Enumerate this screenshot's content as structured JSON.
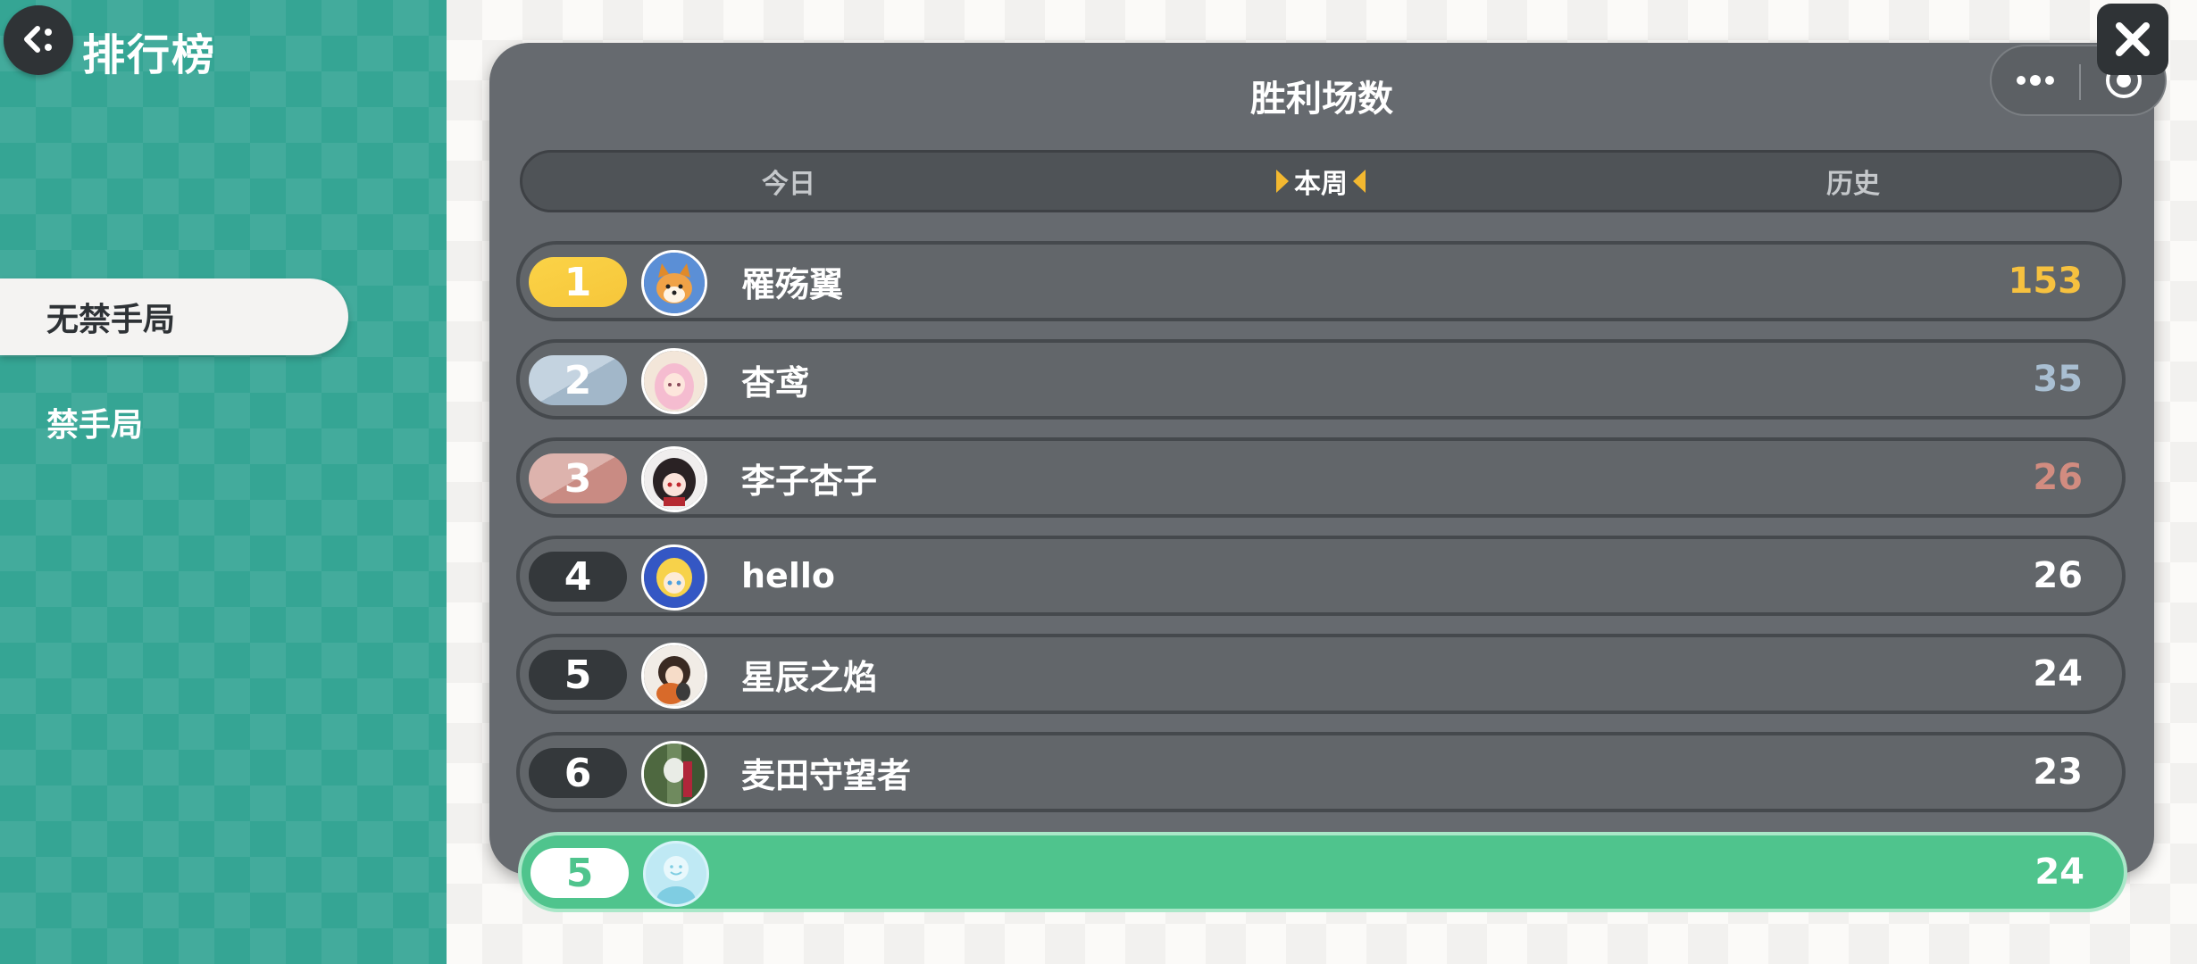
{
  "header": {
    "title": "排行榜",
    "back_icon": "back-arrow-icon"
  },
  "sidebar": {
    "modes": [
      {
        "label": "无禁手局",
        "active": true
      },
      {
        "label": "禁手局",
        "active": false
      }
    ]
  },
  "panel": {
    "title": "胜利场数",
    "tabs": [
      {
        "label": "今日",
        "selected": false
      },
      {
        "label": "本周",
        "selected": true
      },
      {
        "label": "历史",
        "selected": false
      }
    ],
    "rows": [
      {
        "rank": "1",
        "name": "罹殇翼",
        "score": "153",
        "tier": "gold"
      },
      {
        "rank": "2",
        "name": "杳鸢",
        "score": "35",
        "tier": "silver"
      },
      {
        "rank": "3",
        "name": "李子杏子",
        "score": "26",
        "tier": "bronze"
      },
      {
        "rank": "4",
        "name": "hello",
        "score": "26",
        "tier": "normal"
      },
      {
        "rank": "5",
        "name": "星辰之焰",
        "score": "24",
        "tier": "normal"
      },
      {
        "rank": "6",
        "name": "麦田守望者",
        "score": "23",
        "tier": "normal"
      }
    ],
    "my_row": {
      "rank": "5",
      "name": "",
      "score": "24"
    }
  },
  "colors": {
    "sidebar": "#35a594",
    "panel": "#666a6f",
    "gold": "#f6c13f",
    "silver": "#a9bfd2",
    "bronze": "#d28c80",
    "my_row": "#4fc48d"
  },
  "capsule": {
    "more_icon": "more-dots-icon",
    "close_icon": "target-circle-icon",
    "exit_icon": "close-x-icon"
  }
}
